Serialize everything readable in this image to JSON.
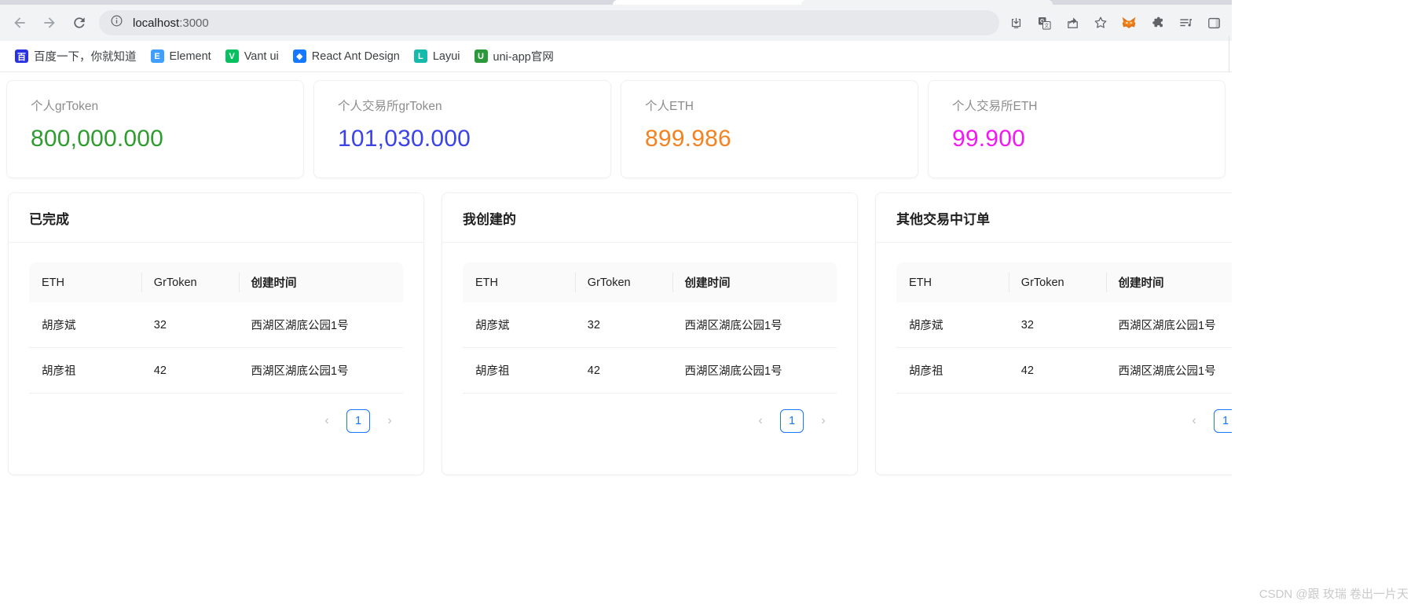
{
  "browser": {
    "back_label": "Back",
    "forward_label": "Forward",
    "reload_label": "Reload",
    "url_host": "localhost",
    "url_port": ":3000",
    "url_full": "localhost:3000",
    "toolbar_icons": [
      {
        "name": "install-app-icon",
        "label": "Install"
      },
      {
        "name": "translate-icon",
        "label": "Translate"
      },
      {
        "name": "share-icon",
        "label": "Share"
      },
      {
        "name": "bookmark-star-icon",
        "label": "Bookmark"
      },
      {
        "name": "metamask-extension-icon",
        "label": "MetaMask"
      },
      {
        "name": "extensions-puzzle-icon",
        "label": "Extensions"
      },
      {
        "name": "reading-list-icon",
        "label": "Reading list"
      },
      {
        "name": "sidebar-icon",
        "label": "Side panel"
      }
    ],
    "bookmarks": [
      {
        "label": "百度一下，你就知道",
        "icon": "baidu-icon",
        "glyph": "百",
        "color": "#2932e1"
      },
      {
        "label": "Element",
        "icon": "element-icon",
        "glyph": "E",
        "color": "#409eff"
      },
      {
        "label": "Vant ui",
        "icon": "vant-icon",
        "glyph": "V",
        "color": "#07c160"
      },
      {
        "label": "React Ant Design",
        "icon": "antd-icon",
        "glyph": "◆",
        "color": "#1677ff"
      },
      {
        "label": "Layui",
        "icon": "layui-icon",
        "glyph": "L",
        "color": "#16baaa"
      },
      {
        "label": "uni-app官网",
        "icon": "uniapp-icon",
        "glyph": "U",
        "color": "#2b9939"
      }
    ]
  },
  "stats": [
    {
      "title": "个人grToken",
      "value": "800,000.000",
      "color": "#2f9c2f"
    },
    {
      "title": "个人交易所grToken",
      "value": "101,030.000",
      "color": "#3b42e8"
    },
    {
      "title": "个人ETH",
      "value": "899.986",
      "color": "#f58220"
    },
    {
      "title": "个人交易所ETH",
      "value": "99.900",
      "color": "#f317f3"
    }
  ],
  "panels": [
    {
      "title": "已完成",
      "columns": [
        "ETH",
        "GrToken",
        "创建时间"
      ],
      "rows": [
        {
          "eth": "胡彦斌",
          "grtoken": "32",
          "time": "西湖区湖底公园1号"
        },
        {
          "eth": "胡彦祖",
          "grtoken": "42",
          "time": "西湖区湖底公园1号"
        }
      ],
      "pagination": {
        "prev": "‹",
        "page": "1",
        "next": "›"
      }
    },
    {
      "title": "我创建的",
      "columns": [
        "ETH",
        "GrToken",
        "创建时间"
      ],
      "rows": [
        {
          "eth": "胡彦斌",
          "grtoken": "32",
          "time": "西湖区湖底公园1号"
        },
        {
          "eth": "胡彦祖",
          "grtoken": "42",
          "time": "西湖区湖底公园1号"
        }
      ],
      "pagination": {
        "prev": "‹",
        "page": "1",
        "next": "›"
      }
    },
    {
      "title": "其他交易中订单",
      "columns": [
        "ETH",
        "GrToken",
        "创建时间"
      ],
      "rows": [
        {
          "eth": "胡彦斌",
          "grtoken": "32",
          "time": "西湖区湖底公园1号"
        },
        {
          "eth": "胡彦祖",
          "grtoken": "42",
          "time": "西湖区湖底公园1号"
        }
      ],
      "pagination": {
        "prev": "‹",
        "page": "1",
        "next": "›"
      }
    }
  ],
  "watermark": "CSDN @跟 玫瑞 卷出一片天"
}
